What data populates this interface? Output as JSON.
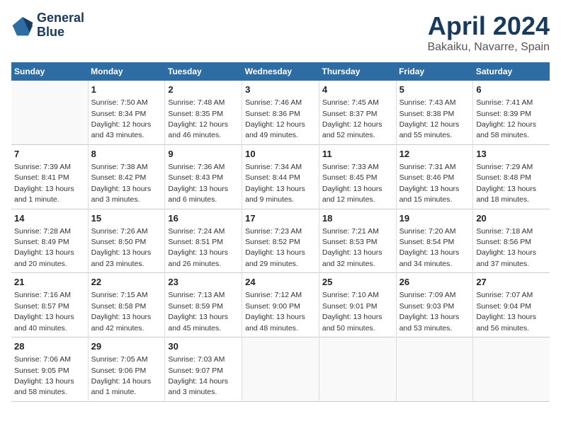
{
  "logo": {
    "line1": "General",
    "line2": "Blue"
  },
  "title": "April 2024",
  "subtitle": "Bakaiku, Navarre, Spain",
  "days_header": [
    "Sunday",
    "Monday",
    "Tuesday",
    "Wednesday",
    "Thursday",
    "Friday",
    "Saturday"
  ],
  "weeks": [
    [
      {
        "day": "",
        "info": ""
      },
      {
        "day": "1",
        "info": "Sunrise: 7:50 AM\nSunset: 8:34 PM\nDaylight: 12 hours\nand 43 minutes."
      },
      {
        "day": "2",
        "info": "Sunrise: 7:48 AM\nSunset: 8:35 PM\nDaylight: 12 hours\nand 46 minutes."
      },
      {
        "day": "3",
        "info": "Sunrise: 7:46 AM\nSunset: 8:36 PM\nDaylight: 12 hours\nand 49 minutes."
      },
      {
        "day": "4",
        "info": "Sunrise: 7:45 AM\nSunset: 8:37 PM\nDaylight: 12 hours\nand 52 minutes."
      },
      {
        "day": "5",
        "info": "Sunrise: 7:43 AM\nSunset: 8:38 PM\nDaylight: 12 hours\nand 55 minutes."
      },
      {
        "day": "6",
        "info": "Sunrise: 7:41 AM\nSunset: 8:39 PM\nDaylight: 12 hours\nand 58 minutes."
      }
    ],
    [
      {
        "day": "7",
        "info": "Sunrise: 7:39 AM\nSunset: 8:41 PM\nDaylight: 13 hours\nand 1 minute."
      },
      {
        "day": "8",
        "info": "Sunrise: 7:38 AM\nSunset: 8:42 PM\nDaylight: 13 hours\nand 3 minutes."
      },
      {
        "day": "9",
        "info": "Sunrise: 7:36 AM\nSunset: 8:43 PM\nDaylight: 13 hours\nand 6 minutes."
      },
      {
        "day": "10",
        "info": "Sunrise: 7:34 AM\nSunset: 8:44 PM\nDaylight: 13 hours\nand 9 minutes."
      },
      {
        "day": "11",
        "info": "Sunrise: 7:33 AM\nSunset: 8:45 PM\nDaylight: 13 hours\nand 12 minutes."
      },
      {
        "day": "12",
        "info": "Sunrise: 7:31 AM\nSunset: 8:46 PM\nDaylight: 13 hours\nand 15 minutes."
      },
      {
        "day": "13",
        "info": "Sunrise: 7:29 AM\nSunset: 8:48 PM\nDaylight: 13 hours\nand 18 minutes."
      }
    ],
    [
      {
        "day": "14",
        "info": "Sunrise: 7:28 AM\nSunset: 8:49 PM\nDaylight: 13 hours\nand 20 minutes."
      },
      {
        "day": "15",
        "info": "Sunrise: 7:26 AM\nSunset: 8:50 PM\nDaylight: 13 hours\nand 23 minutes."
      },
      {
        "day": "16",
        "info": "Sunrise: 7:24 AM\nSunset: 8:51 PM\nDaylight: 13 hours\nand 26 minutes."
      },
      {
        "day": "17",
        "info": "Sunrise: 7:23 AM\nSunset: 8:52 PM\nDaylight: 13 hours\nand 29 minutes."
      },
      {
        "day": "18",
        "info": "Sunrise: 7:21 AM\nSunset: 8:53 PM\nDaylight: 13 hours\nand 32 minutes."
      },
      {
        "day": "19",
        "info": "Sunrise: 7:20 AM\nSunset: 8:54 PM\nDaylight: 13 hours\nand 34 minutes."
      },
      {
        "day": "20",
        "info": "Sunrise: 7:18 AM\nSunset: 8:56 PM\nDaylight: 13 hours\nand 37 minutes."
      }
    ],
    [
      {
        "day": "21",
        "info": "Sunrise: 7:16 AM\nSunset: 8:57 PM\nDaylight: 13 hours\nand 40 minutes."
      },
      {
        "day": "22",
        "info": "Sunrise: 7:15 AM\nSunset: 8:58 PM\nDaylight: 13 hours\nand 42 minutes."
      },
      {
        "day": "23",
        "info": "Sunrise: 7:13 AM\nSunset: 8:59 PM\nDaylight: 13 hours\nand 45 minutes."
      },
      {
        "day": "24",
        "info": "Sunrise: 7:12 AM\nSunset: 9:00 PM\nDaylight: 13 hours\nand 48 minutes."
      },
      {
        "day": "25",
        "info": "Sunrise: 7:10 AM\nSunset: 9:01 PM\nDaylight: 13 hours\nand 50 minutes."
      },
      {
        "day": "26",
        "info": "Sunrise: 7:09 AM\nSunset: 9:03 PM\nDaylight: 13 hours\nand 53 minutes."
      },
      {
        "day": "27",
        "info": "Sunrise: 7:07 AM\nSunset: 9:04 PM\nDaylight: 13 hours\nand 56 minutes."
      }
    ],
    [
      {
        "day": "28",
        "info": "Sunrise: 7:06 AM\nSunset: 9:05 PM\nDaylight: 13 hours\nand 58 minutes."
      },
      {
        "day": "29",
        "info": "Sunrise: 7:05 AM\nSunset: 9:06 PM\nDaylight: 14 hours\nand 1 minute."
      },
      {
        "day": "30",
        "info": "Sunrise: 7:03 AM\nSunset: 9:07 PM\nDaylight: 14 hours\nand 3 minutes."
      },
      {
        "day": "",
        "info": ""
      },
      {
        "day": "",
        "info": ""
      },
      {
        "day": "",
        "info": ""
      },
      {
        "day": "",
        "info": ""
      }
    ]
  ]
}
